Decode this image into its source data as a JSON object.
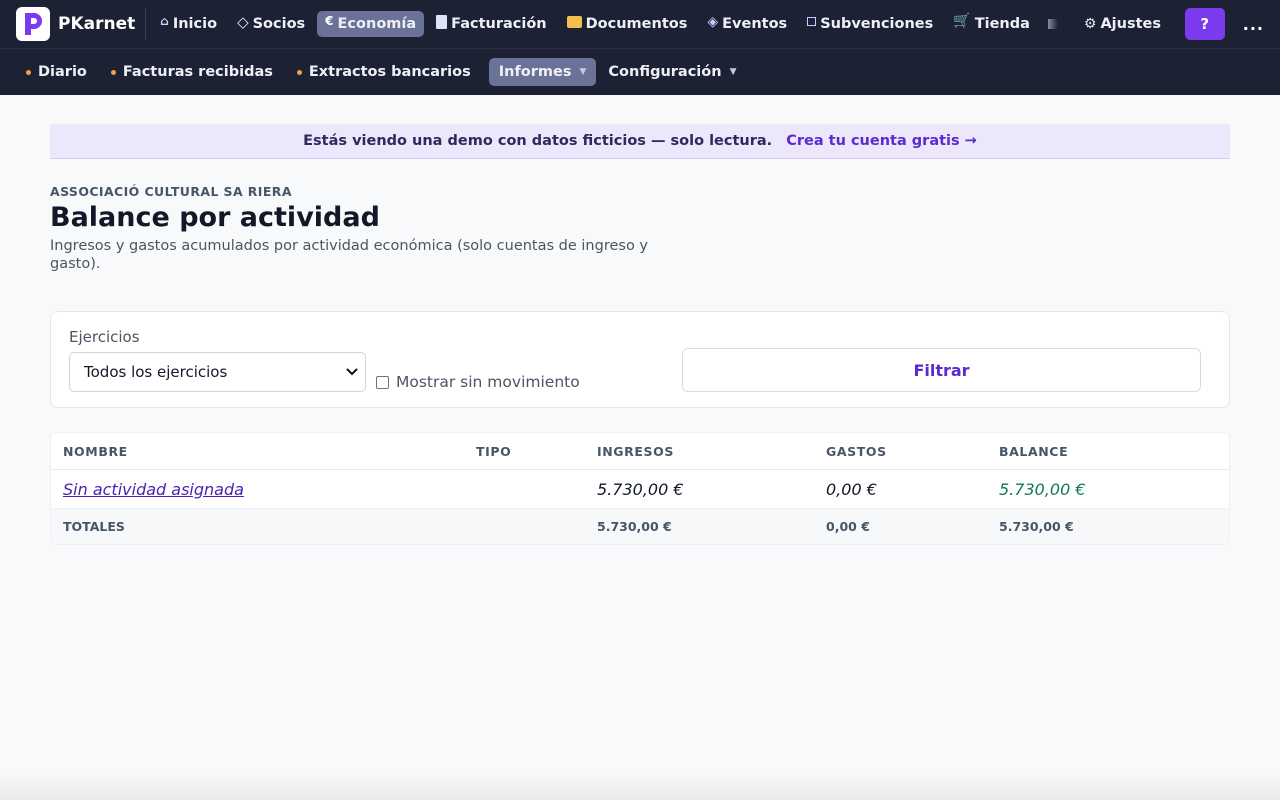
{
  "app": {
    "name": "PKarnet"
  },
  "nav": {
    "items": [
      {
        "icon": "home-icon",
        "label": "Inicio"
      },
      {
        "icon": "diamond-icon",
        "label": "Socios"
      },
      {
        "icon": "euro-icon",
        "label": "Economía",
        "active": true
      },
      {
        "icon": "invoice-icon",
        "label": "Facturación"
      },
      {
        "icon": "folder-icon",
        "label": "Documentos"
      },
      {
        "icon": "event-icon",
        "label": "Eventos"
      },
      {
        "icon": "grant-icon",
        "label": "Subvenciones"
      },
      {
        "icon": "cart-icon",
        "label": "Tienda"
      }
    ],
    "settings_label": "Ajustes",
    "help_label": "?",
    "more_label": "..."
  },
  "subnav": {
    "items": [
      {
        "label": "Diario",
        "dot": true
      },
      {
        "label": "Facturas recibidas",
        "dot": true
      },
      {
        "label": "Extractos bancarios",
        "dot": true
      },
      {
        "label": "Informes",
        "active": true,
        "dropdown": true
      },
      {
        "label": "Configuración",
        "dropdown": true
      }
    ]
  },
  "banner": {
    "text": "Estás viendo una demo con datos ficticios — solo lectura.",
    "link": "Crea tu cuenta gratis →"
  },
  "page": {
    "org": "ASSOCIACIÓ CULTURAL SA RIERA",
    "title": "Balance por actividad",
    "subtitle": "Ingresos y gastos acumulados por actividad económica (solo cuentas de ingreso y gasto)."
  },
  "filters": {
    "label": "Ejercicios",
    "selected": "Todos los ejercicios",
    "checkbox_label": "Mostrar sin movimiento",
    "checkbox_checked": false,
    "button": "Filtrar"
  },
  "table": {
    "headers": [
      "NOMBRE",
      "TIPO",
      "INGRESOS",
      "GASTOS",
      "BALANCE"
    ],
    "rows": [
      {
        "nombre": "Sin actividad asignada",
        "tipo": "",
        "ingresos": "5.730,00 €",
        "gastos": "0,00 €",
        "balance": "5.730,00 €"
      }
    ],
    "totals": {
      "label": "TOTALES",
      "ingresos": "5.730,00 €",
      "gastos": "0,00 €",
      "balance": "5.730,00 €"
    }
  },
  "colors": {
    "accent": "#7c3aed",
    "nav_bg": "#1c2133",
    "active_bg": "#6a7297",
    "positive": "#0f7b52",
    "link": "#4c1fb3"
  }
}
